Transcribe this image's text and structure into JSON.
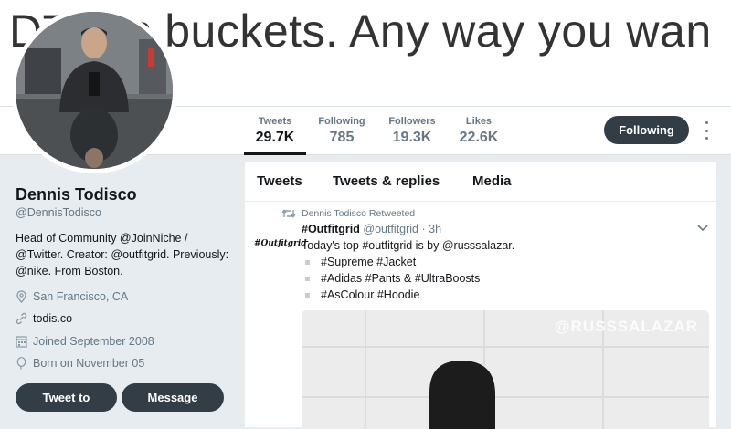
{
  "banner": {
    "text": "DTodis buckets. Any way you wan"
  },
  "nav": {
    "stats": [
      {
        "label": "Tweets",
        "value": "29.7K"
      },
      {
        "label": "Following",
        "value": "785"
      },
      {
        "label": "Followers",
        "value": "19.3K"
      },
      {
        "label": "Likes",
        "value": "22.6K"
      }
    ],
    "following_button": "Following"
  },
  "profile": {
    "name": "Dennis Todisco",
    "handle": "@DennisTodisco",
    "bio": "Head of Community @JoinNiche / @Twitter. Creator: @outfitgrid. Previously: @nike. From Boston.",
    "location": "San Francisco, CA",
    "website": "todis.co",
    "joined": "Joined September 2008",
    "born": "Born on November 05",
    "tweet_to_button": "Tweet to",
    "message_button": "Message"
  },
  "timeline": {
    "tabs": [
      "Tweets",
      "Tweets & replies",
      "Media"
    ],
    "tweet": {
      "retweet_note": "Dennis Todisco Retweeted",
      "logo_text": "#Outfitgrid",
      "author_name": "#Outfitgrid",
      "author_handle": "@outfitgrid",
      "time": "· 3h",
      "text": "Today's top #outfitgrid is by @russsalazar.",
      "bullets": [
        "#Supreme #Jacket",
        "#Adidas #Pants & #UltraBoosts",
        "#AsColour #Hoodie"
      ],
      "image_watermark": "@RUSSSALAZAR"
    }
  }
}
